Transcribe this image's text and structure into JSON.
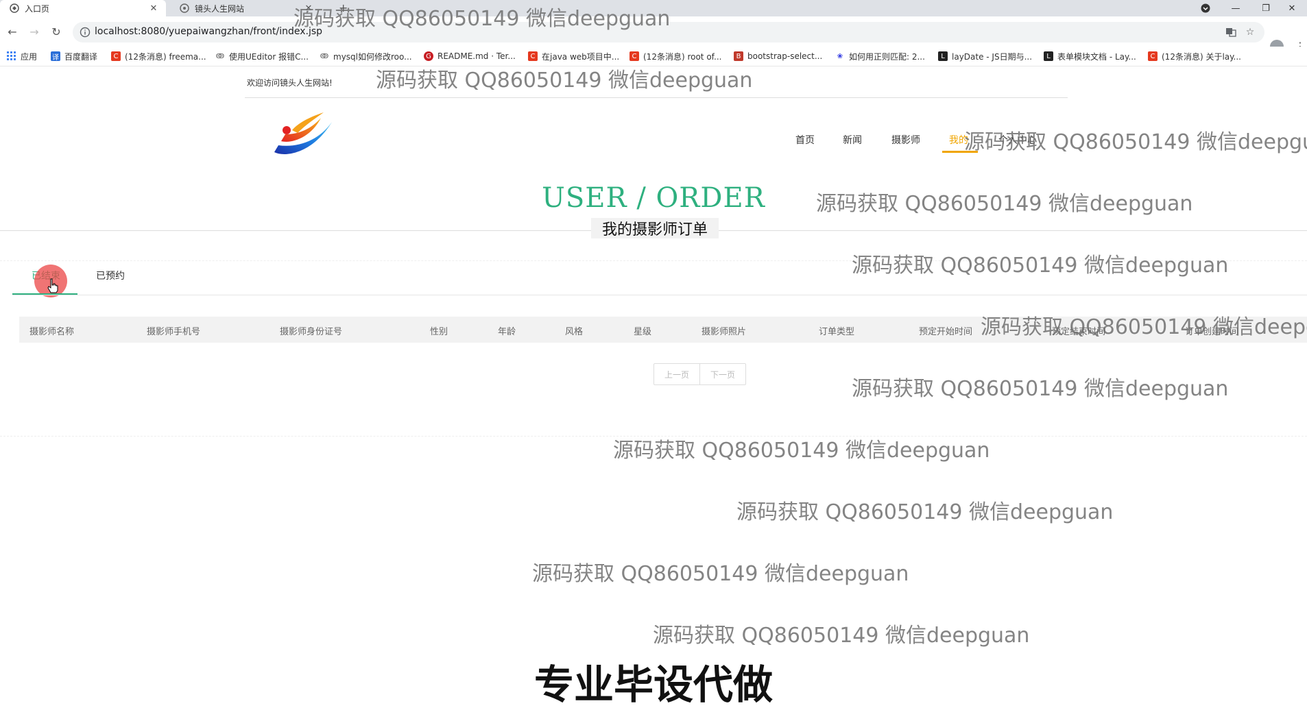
{
  "browser": {
    "tabs": [
      {
        "title": "入口页",
        "active": true
      },
      {
        "title": "镜头人生网站",
        "active": false
      }
    ],
    "new_tab_glyph": "+",
    "url": "localhost:8080/yuepaiwangzhan/front/index.jsp",
    "bookmarks": [
      {
        "label": "应用",
        "icon": "apps-grid-icon",
        "color": "#4285f4"
      },
      {
        "label": "百度翻译",
        "icon": "baidu-translate-icon",
        "color": "#2a6ed8"
      },
      {
        "label": "(12条消息) freema...",
        "icon": "csdn-icon",
        "color": "#e5391f"
      },
      {
        "label": "使用UEditor 报错C...",
        "icon": "cnblogs-icon",
        "color": "#555555"
      },
      {
        "label": "mysql如何修改roo...",
        "icon": "cnblogs-icon",
        "color": "#555555"
      },
      {
        "label": "README.md · Ter...",
        "icon": "gitee-icon",
        "color": "#c71d23"
      },
      {
        "label": "在java web项目中...",
        "icon": "csdn-icon",
        "color": "#e5391f"
      },
      {
        "label": "(12条消息) root of...",
        "icon": "csdn-icon",
        "color": "#e5391f"
      },
      {
        "label": "bootstrap-select...",
        "icon": "bootstrap-icon",
        "color": "#c0392b"
      },
      {
        "label": "如何用正则匹配: 2...",
        "icon": "baidu-paw-icon",
        "color": "#2932e1"
      },
      {
        "label": "layDate - JS日期与...",
        "icon": "layui-icon",
        "color": "#222222"
      },
      {
        "label": "表单模块文档 - Lay...",
        "icon": "layui-icon",
        "color": "#222222"
      },
      {
        "label": "(12条消息) 关于lay...",
        "icon": "csdn-icon",
        "color": "#e5391f"
      }
    ]
  },
  "site": {
    "welcome": "欢迎访问镜头人生网站!",
    "logo_icon": "phoenix-logo-icon",
    "nav": [
      "首页",
      "新闻",
      "摄影师",
      "我的",
      "个人中心"
    ],
    "active_nav": "我的"
  },
  "section": {
    "title": "USER / ORDER",
    "subtitle": "我的摄影师订单"
  },
  "order_tabs": [
    "已结束",
    "已预约"
  ],
  "active_tab": "已结束",
  "table": {
    "headers": [
      "摄影师名称",
      "摄影师手机号",
      "摄影师身份证号",
      "性别",
      "年龄",
      "风格",
      "星级",
      "摄影师照片",
      "订单类型",
      "预定开始时间",
      "预定结束时间",
      "订单创建时间"
    ],
    "rows": []
  },
  "pager": {
    "prev": "上一页",
    "next": "下一页"
  },
  "watermark": "源码获取 QQ86050149 微信deepguan",
  "banner": "专业毕设代做",
  "colors": {
    "accent": "#2eb07f",
    "nav_active": "#f0a500"
  }
}
